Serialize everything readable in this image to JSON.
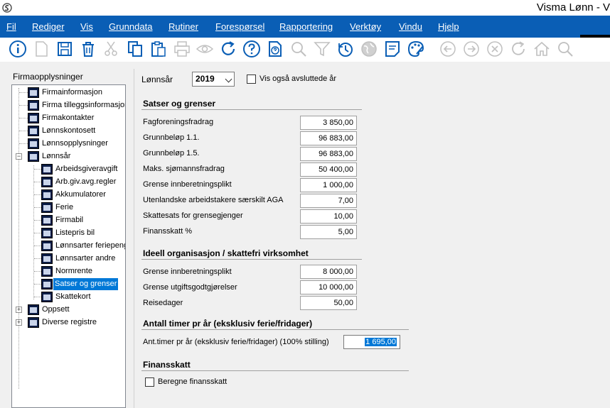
{
  "window": {
    "title": "Visma Lønn - V"
  },
  "menu": [
    "Fil",
    "Rediger",
    "Vis",
    "Grunndata",
    "Rutiner",
    "Forespørsel",
    "Rapportering",
    "Verktøy",
    "Vindu",
    "Hjelp"
  ],
  "toolbar_icons": [
    "info-icon",
    "new-document-icon",
    "save-icon",
    "delete-icon",
    "cut-icon",
    "copy-icon",
    "paste-icon",
    "print-icon",
    "preview-icon",
    "refresh-icon",
    "help-icon",
    "document-help-icon",
    "search-icon",
    "filter-icon",
    "history-icon",
    "globe-icon",
    "note-icon",
    "palette-icon",
    "back-icon",
    "forward-icon",
    "cancel-icon",
    "reload-icon",
    "home-icon",
    "find-icon"
  ],
  "tree": {
    "title": "Firmaopplysninger",
    "items": [
      {
        "label": "Firmainformasjon",
        "level": 0
      },
      {
        "label": "Firma tilleggsinformasjon",
        "level": 0
      },
      {
        "label": "Firmakontakter",
        "level": 0
      },
      {
        "label": "Lønnskontosett",
        "level": 0
      },
      {
        "label": "Lønnsopplysninger",
        "level": 0
      },
      {
        "label": "Lønnsår",
        "level": 0,
        "expander": "−"
      },
      {
        "label": "Arbeidsgiveravgift",
        "level": 1
      },
      {
        "label": "Arb.giv.avg.regler",
        "level": 1
      },
      {
        "label": "Akkumulatorer",
        "level": 1
      },
      {
        "label": "Ferie",
        "level": 1
      },
      {
        "label": "Firmabil",
        "level": 1
      },
      {
        "label": "Listepris bil",
        "level": 1
      },
      {
        "label": "Lønnsarter feriepenger",
        "level": 1
      },
      {
        "label": "Lønnsarter andre",
        "level": 1
      },
      {
        "label": "Normrente",
        "level": 1
      },
      {
        "label": "Satser og grenser",
        "level": 1,
        "selected": true
      },
      {
        "label": "Skattekort",
        "level": 1
      },
      {
        "label": "Oppsett",
        "level": 0,
        "expander": "+"
      },
      {
        "label": "Diverse registre",
        "level": 0,
        "expander": "+"
      }
    ]
  },
  "form": {
    "year_label": "Lønnsår",
    "year_value": "2019",
    "show_closed_label": "Vis også avsluttede år",
    "section1_title": "Satser og grenser",
    "rows1": [
      {
        "label": "Fagforeningsfradrag",
        "value": "3 850,00"
      },
      {
        "label": "Grunnbeløp 1.1.",
        "value": "96 883,00"
      },
      {
        "label": "Grunnbeløp 1.5.",
        "value": "96 883,00"
      },
      {
        "label": "Maks. sjømannsfradrag",
        "value": "50 400,00"
      },
      {
        "label": "Grense innberetningsplikt",
        "value": "1 000,00"
      },
      {
        "label": "Utenlandske arbeidstakere særskilt AGA",
        "value": "7,00"
      },
      {
        "label": "Skattesats for grensegjenger",
        "value": "10,00"
      },
      {
        "label": "Finansskatt %",
        "value": "5,00"
      }
    ],
    "section2_title": "Ideell organisasjon / skattefri virksomhet",
    "rows2": [
      {
        "label": "Grense innberetningsplikt",
        "value": "8 000,00"
      },
      {
        "label": "Grense utgiftsgodtgjørelser",
        "value": "10 000,00"
      },
      {
        "label": "Reisedager",
        "value": "50,00"
      }
    ],
    "section3_title": "Antall timer pr år (eksklusiv ferie/fridager)",
    "hours_label": "Ant.timer pr år (eksklusiv ferie/fridager) (100% stilling)",
    "hours_value": "1 695,00",
    "section4_title": "Finansskatt",
    "finance_tax_label": "Beregne finansskatt"
  }
}
